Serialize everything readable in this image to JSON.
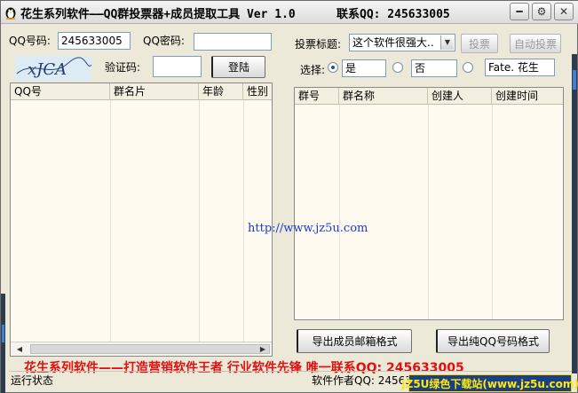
{
  "window": {
    "title": "花生系列软件——QQ群投票器+成员提取工具 Ver 1.0",
    "contact": "联系QQ: 245633005",
    "buttons": {
      "minimize": "━",
      "settings": "⚙",
      "close": "✕"
    }
  },
  "login": {
    "qq_label": "QQ号码:",
    "qq_value": "245633005",
    "password_label": "QQ密码:",
    "password_value": "",
    "captcha_label": "验证码:",
    "captcha_value": "",
    "captcha_text": "xJCA",
    "login_button": "登陆"
  },
  "vote": {
    "title_label": "投票标题:",
    "title_selected": "这个软件很强大..",
    "vote_button": "投票",
    "auto_vote_button": "自动投票",
    "choice_label": "选择:",
    "options": [
      "是",
      "否",
      "Fate. 花生"
    ]
  },
  "members_table": {
    "columns": [
      "QQ号",
      "群名片",
      "年龄",
      "性别"
    ]
  },
  "groups_table": {
    "columns": [
      "群号",
      "群名称",
      "创建人",
      "创建时间"
    ]
  },
  "url": "http://www.jz5u.com",
  "export": {
    "email_button": "导出成员邮箱格式",
    "qq_button": "导出纯QQ号码格式"
  },
  "banner": "花生系列软件——打造营销软件王者 行业软件先锋 唯一联系QQ: 245633005",
  "status": {
    "left": "运行状态",
    "right": "软件作者QQ: 245633",
    "watermark": "JZ5U绿色下载站(www.jz5u.com)"
  }
}
